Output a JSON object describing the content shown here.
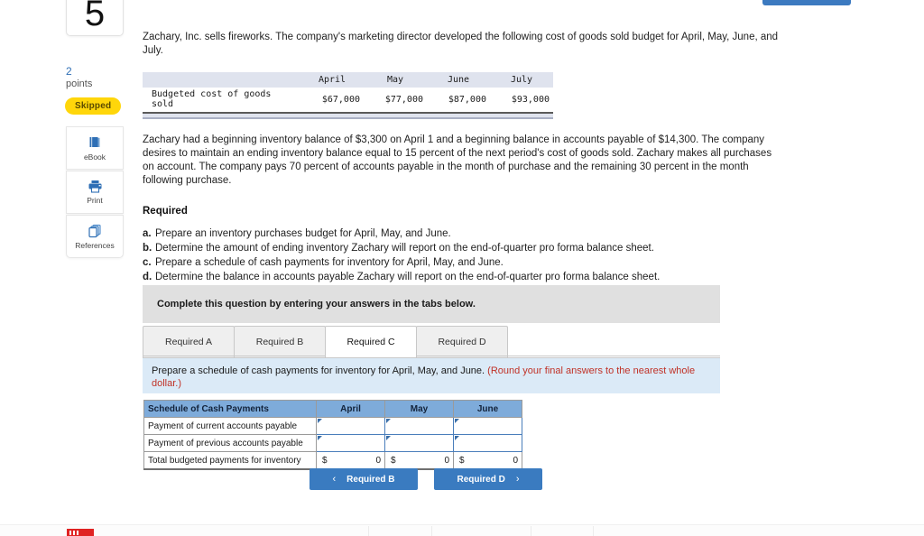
{
  "question": {
    "number": "5",
    "points_value": "2",
    "points_label": "points",
    "status_badge": "Skipped"
  },
  "tools": [
    {
      "label": "eBook",
      "icon": "book-icon"
    },
    {
      "label": "Print",
      "icon": "printer-icon"
    },
    {
      "label": "References",
      "icon": "copy-icon"
    }
  ],
  "problem": {
    "intro": "Zachary, Inc. sells fireworks. The company's marketing director developed the following cost of goods sold budget for April, May, June, and July.",
    "paragraph": "Zachary had a beginning inventory balance of $3,300 on April 1 and a beginning balance in accounts payable of $14,300. The company desires to maintain an ending inventory balance equal to 15 percent of the next period's cost of goods sold. Zachary makes all purchases on account. The company pays 70 percent of accounts payable in the month of purchase and the remaining 30 percent in the month following purchase."
  },
  "cogs_table": {
    "months": [
      "April",
      "May",
      "June",
      "July"
    ],
    "row_label": "Budgeted cost of goods sold",
    "values": [
      "$67,000",
      "$77,000",
      "$87,000",
      "$93,000"
    ]
  },
  "required": {
    "heading": "Required",
    "items": [
      {
        "letter": "a.",
        "text": "Prepare an inventory purchases budget for April, May, and June."
      },
      {
        "letter": "b.",
        "text": "Determine the amount of ending inventory Zachary will report on the end-of-quarter pro forma balance sheet."
      },
      {
        "letter": "c.",
        "text": "Prepare a schedule of cash payments for inventory for April, May, and June."
      },
      {
        "letter": "d.",
        "text": "Determine the balance in accounts payable Zachary will report on the end-of-quarter pro forma balance sheet."
      }
    ]
  },
  "instruction_bar": "Complete this question by entering your answers in the tabs below.",
  "tabs": [
    {
      "label": "Required A",
      "active": false
    },
    {
      "label": "Required B",
      "active": false
    },
    {
      "label": "Required C",
      "active": true
    },
    {
      "label": "Required D",
      "active": false
    }
  ],
  "tab_instruction": {
    "main": "Prepare a schedule of cash payments for inventory for April, May, and June. ",
    "emphasis": "(Round your final answers to the nearest whole dollar.)",
    "emphasis_color": "#c03227"
  },
  "answer_grid": {
    "header_title": "Schedule of Cash Payments",
    "columns": [
      "April",
      "May",
      "June"
    ],
    "rows": [
      {
        "label": "Payment of current accounts payable",
        "type": "input",
        "cells": [
          "",
          "",
          ""
        ]
      },
      {
        "label": "Payment of previous accounts payable",
        "type": "input",
        "cells": [
          "",
          "",
          ""
        ]
      },
      {
        "label": "Total budgeted payments for inventory",
        "type": "total",
        "currency": "$",
        "cells": [
          "0",
          "0",
          "0"
        ]
      }
    ],
    "header_bg": "#7eabda"
  },
  "nav": {
    "prev_label": "Required B",
    "prev_chevron": "‹",
    "next_label": "Required D",
    "next_chevron": "›",
    "button_color": "#3a7bc0"
  }
}
